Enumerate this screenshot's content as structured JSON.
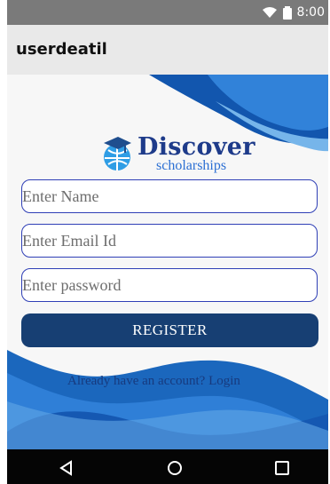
{
  "status_bar": {
    "time": "8:00"
  },
  "action_bar": {
    "title": "userdeatil"
  },
  "logo": {
    "title": "Discover",
    "subtitle": "scholarships"
  },
  "form": {
    "name_placeholder": "Enter Name",
    "email_placeholder": "Enter Email Id",
    "password_placeholder": "Enter password",
    "register_label": "REGISTER",
    "login_text": "Already have an account? Login"
  },
  "colors": {
    "accent": "#173f73",
    "field_border": "#2f3fb6",
    "wave_dark": "#175fb7",
    "wave_light": "#63a7e6",
    "nav_background": "#050505"
  },
  "icons": {
    "status": [
      "wifi-icon",
      "battery-icon"
    ],
    "navigation": [
      "back-icon",
      "home-icon",
      "recents-icon"
    ],
    "logo": "graduation-globe-icon"
  }
}
